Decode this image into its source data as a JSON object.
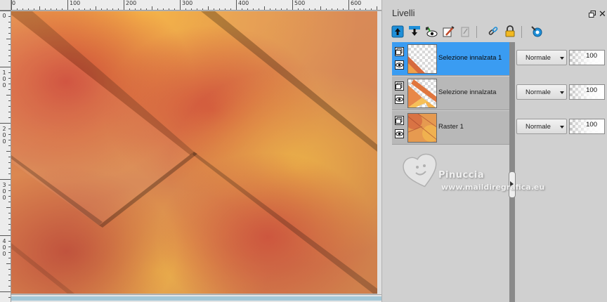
{
  "ruler_top": {
    "labels": [
      "0",
      "100",
      "200",
      "300",
      "400",
      "500",
      "600"
    ]
  },
  "ruler_left": {
    "labels": [
      [
        "0"
      ],
      [
        "1",
        "0",
        "0"
      ],
      [
        "2",
        "0",
        "0"
      ],
      [
        "3",
        "0",
        "0"
      ],
      [
        "4",
        "0",
        "0"
      ]
    ]
  },
  "layers_panel": {
    "title": "Livelli",
    "toolbar": [
      "new-raster-layer-icon",
      "merge-down-icon",
      "show-hide-icon",
      "layer-properties-icon",
      "delete-layer-icon",
      "link-icon",
      "lock-icon",
      "settings-icon"
    ],
    "layers": [
      {
        "name": "Selezione innalzata 1",
        "blend_mode": "Normale",
        "opacity": "100",
        "selected": true
      },
      {
        "name": "Selezione innalzata",
        "blend_mode": "Normale",
        "opacity": "100",
        "selected": false
      },
      {
        "name": "Raster 1",
        "blend_mode": "Normale",
        "opacity": "100",
        "selected": false
      }
    ]
  },
  "watermark": {
    "line1": "Pinuccia",
    "line2": "www.maildiregrafica.eu"
  },
  "colors": {
    "selected_row": "#3a9cf2",
    "accent_blue": "#1f8fd8"
  }
}
